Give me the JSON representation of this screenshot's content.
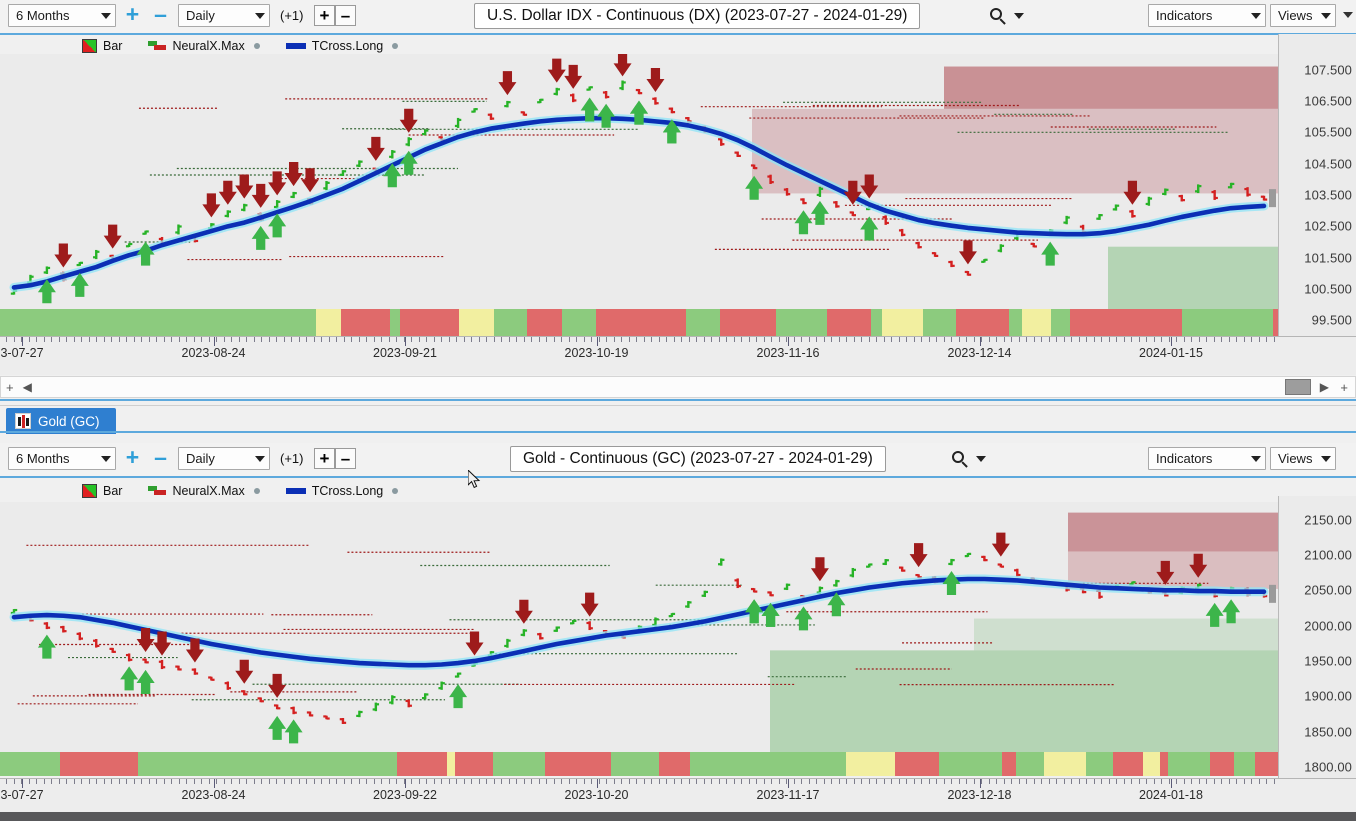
{
  "panels": [
    {
      "id": "dx",
      "toolbar": {
        "range_label": "6 Months",
        "range_plus": "+",
        "range_minus": "–",
        "interval_label": "Daily",
        "offset_label": "(+1)",
        "interval_plus": "+",
        "interval_minus": "–",
        "title": "U.S. Dollar IDX - Continuous (DX) (2023-07-27 - 2024-01-29)",
        "search_icon": "magnifier-icon",
        "indicators_label": "Indicators",
        "views_label": "Views"
      },
      "legend": [
        {
          "name": "Bar",
          "swatch": "bar-swatch"
        },
        {
          "name": "NeuralX.Max",
          "swatch": "neuralx-swatch"
        },
        {
          "name": "TCross.Long",
          "swatch": "tcross-swatch"
        }
      ],
      "scrollbar": {
        "left_arrow": "◀",
        "right_arrow": "▶",
        "plus_left": "+",
        "plus_right": "+"
      }
    },
    {
      "id": "gc",
      "tab_label": "Gold (GC)",
      "toolbar": {
        "range_label": "6 Months",
        "range_plus": "+",
        "range_minus": "–",
        "interval_label": "Daily",
        "offset_label": "(+1)",
        "interval_plus": "+",
        "interval_minus": "–",
        "title": "Gold - Continuous (GC) (2023-07-27 - 2024-01-29)",
        "search_icon": "magnifier-icon",
        "indicators_label": "Indicators",
        "views_label": "Views"
      },
      "legend": [
        {
          "name": "Bar",
          "swatch": "bar-swatch"
        },
        {
          "name": "NeuralX.Max",
          "swatch": "neuralx-swatch"
        },
        {
          "name": "TCross.Long",
          "swatch": "tcross-swatch"
        }
      ]
    }
  ],
  "colors": {
    "up_bar": "#27b327",
    "down_bar": "#d42020",
    "tcross_line": "#0b2fb5",
    "buy_arrow": "#3cb54a",
    "sell_arrow": "#9e1b1b",
    "zone_red": "#c07a80",
    "zone_green": "#8fc48f",
    "accent": "#5da9dd",
    "tab_active": "#2f7fd0"
  },
  "chart_data": [
    {
      "type": "line",
      "title": "U.S. Dollar IDX - Continuous (DX) (2023-07-27 - 2024-01-29)",
      "symbol": "DX",
      "interval": "Daily",
      "range": "6 Months",
      "xlabel": "",
      "ylabel": "",
      "ylim": [
        99.0,
        108.0
      ],
      "grid": false,
      "legend_position": "top-left",
      "y_ticks": [
        "107.500",
        "106.500",
        "105.500",
        "104.500",
        "103.500",
        "102.500",
        "101.500",
        "100.500",
        "99.500"
      ],
      "y_tick_values": [
        107.5,
        106.5,
        105.5,
        104.5,
        103.5,
        102.5,
        101.5,
        100.5,
        99.5
      ],
      "x_ticks": [
        "3-07-27",
        "2023-08-24",
        "2023-09-21",
        "2023-10-19",
        "2023-11-16",
        "2023-12-14",
        "2024-01-15"
      ],
      "series": [
        {
          "name": "TCross.Long",
          "color": "#0b2fb5",
          "values": [
            100.55,
            100.62,
            100.74,
            100.9,
            101.05,
            101.2,
            101.4,
            101.58,
            101.72,
            101.9,
            102.05,
            102.2,
            102.35,
            102.5,
            102.62,
            102.78,
            102.95,
            103.12,
            103.3,
            103.5,
            103.7,
            103.95,
            104.2,
            104.45,
            104.7,
            104.95,
            105.15,
            105.35,
            105.5,
            105.62,
            105.7,
            105.78,
            105.85,
            105.9,
            105.93,
            105.95,
            105.95,
            105.93,
            105.9,
            105.85,
            105.8,
            105.72,
            105.6,
            105.45,
            105.25,
            105.0,
            104.72,
            104.45,
            104.2,
            103.95,
            103.7,
            103.45,
            103.2,
            103.0,
            102.85,
            102.7,
            102.6,
            102.52,
            102.45,
            102.4,
            102.35,
            102.3,
            102.28,
            102.26,
            102.25,
            102.25,
            102.28,
            102.35,
            102.45,
            102.55,
            102.68,
            102.8,
            102.9,
            103.0,
            103.08,
            103.12,
            103.15
          ]
        },
        {
          "name": "Price",
          "color": "#27b327",
          "values": [
            100.4,
            100.8,
            101.1,
            100.9,
            101.3,
            101.6,
            101.5,
            101.9,
            102.3,
            102.0,
            102.4,
            102.1,
            102.5,
            102.9,
            103.1,
            102.8,
            103.2,
            103.5,
            103.3,
            103.8,
            104.2,
            104.5,
            104.3,
            104.8,
            105.2,
            105.5,
            105.3,
            105.8,
            106.2,
            106.0,
            106.4,
            106.1,
            106.5,
            106.8,
            106.6,
            106.9,
            106.7,
            107.0,
            106.8,
            106.5,
            106.2,
            105.9,
            105.6,
            105.2,
            104.8,
            104.4,
            104.0,
            103.6,
            103.3,
            103.6,
            103.2,
            102.9,
            103.1,
            102.7,
            102.3,
            101.9,
            101.6,
            101.3,
            101.0,
            101.4,
            101.8,
            102.2,
            101.9,
            102.3,
            102.7,
            102.4,
            102.8,
            103.1,
            102.9,
            103.3,
            103.6,
            103.4,
            103.7,
            103.5,
            103.8,
            103.6,
            103.4
          ]
        }
      ],
      "annotations": [
        {
          "kind": "sell-arrow",
          "count": 22
        },
        {
          "kind": "buy-arrow",
          "count": 19
        },
        {
          "kind": "zone-resistance",
          "color": "#c07a80"
        },
        {
          "kind": "zone-support",
          "color": "#8fc48f"
        }
      ]
    },
    {
      "type": "line",
      "title": "Gold - Continuous (GC) (2023-07-27 - 2024-01-29)",
      "symbol": "GC",
      "interval": "Daily",
      "range": "6 Months",
      "xlabel": "",
      "ylabel": "",
      "ylim": [
        1790,
        2175
      ],
      "grid": false,
      "legend_position": "top-left",
      "y_ticks": [
        "2150.00",
        "2100.00",
        "2050.00",
        "2000.00",
        "1950.00",
        "1900.00",
        "1850.00",
        "1800.00"
      ],
      "y_tick_values": [
        2150,
        2100,
        2050,
        2000,
        1950,
        1900,
        1850,
        1800
      ],
      "x_ticks": [
        "3-07-27",
        "2023-08-24",
        "2023-09-22",
        "2023-10-20",
        "2023-11-17",
        "2023-12-18",
        "2024-01-18"
      ],
      "series": [
        {
          "name": "TCross.Long",
          "color": "#0b2fb5",
          "values": [
            2012,
            2014,
            2015,
            2014,
            2012,
            2008,
            2004,
            1999,
            1994,
            1989,
            1984,
            1979,
            1974,
            1970,
            1966,
            1962,
            1959,
            1956,
            1953,
            1951,
            1949,
            1947,
            1946,
            1945,
            1944,
            1944,
            1945,
            1947,
            1950,
            1954,
            1959,
            1964,
            1969,
            1974,
            1978,
            1982,
            1986,
            1989,
            1992,
            1995,
            1998,
            2002,
            2006,
            2011,
            2016,
            2021,
            2026,
            2031,
            2036,
            2041,
            2046,
            2050,
            2054,
            2057,
            2060,
            2062,
            2064,
            2065,
            2066,
            2066,
            2065,
            2064,
            2062,
            2060,
            2058,
            2056,
            2054,
            2053,
            2052,
            2051,
            2050,
            2050,
            2049,
            2049,
            2048,
            2048,
            2048
          ]
        },
        {
          "name": "Price",
          "color": "#27b327",
          "values": [
            2020,
            2010,
            2000,
            1995,
            1985,
            1975,
            1965,
            1955,
            1950,
            1945,
            1940,
            1935,
            1925,
            1915,
            1905,
            1895,
            1885,
            1880,
            1875,
            1870,
            1865,
            1875,
            1885,
            1895,
            1890,
            1900,
            1915,
            1930,
            1945,
            1960,
            1975,
            1990,
            1985,
            1995,
            2005,
            2000,
            1990,
            1985,
            1995,
            2005,
            2015,
            2030,
            2045,
            2090,
            2060,
            2050,
            2045,
            2055,
            2040,
            2050,
            2060,
            2075,
            2085,
            2090,
            2080,
            2070,
            2065,
            2090,
            2100,
            2095,
            2085,
            2075,
            2065,
            2060,
            2055,
            2050,
            2045,
            2055,
            2060,
            2050,
            2045,
            2050,
            2055,
            2045,
            2050,
            2048,
            2045
          ]
        }
      ],
      "annotations": [
        {
          "kind": "sell-arrow",
          "count": 14
        },
        {
          "kind": "buy-arrow",
          "count": 16
        },
        {
          "kind": "zone-resistance",
          "color": "#c07a80"
        },
        {
          "kind": "zone-support",
          "color": "#8fc48f"
        }
      ]
    }
  ]
}
